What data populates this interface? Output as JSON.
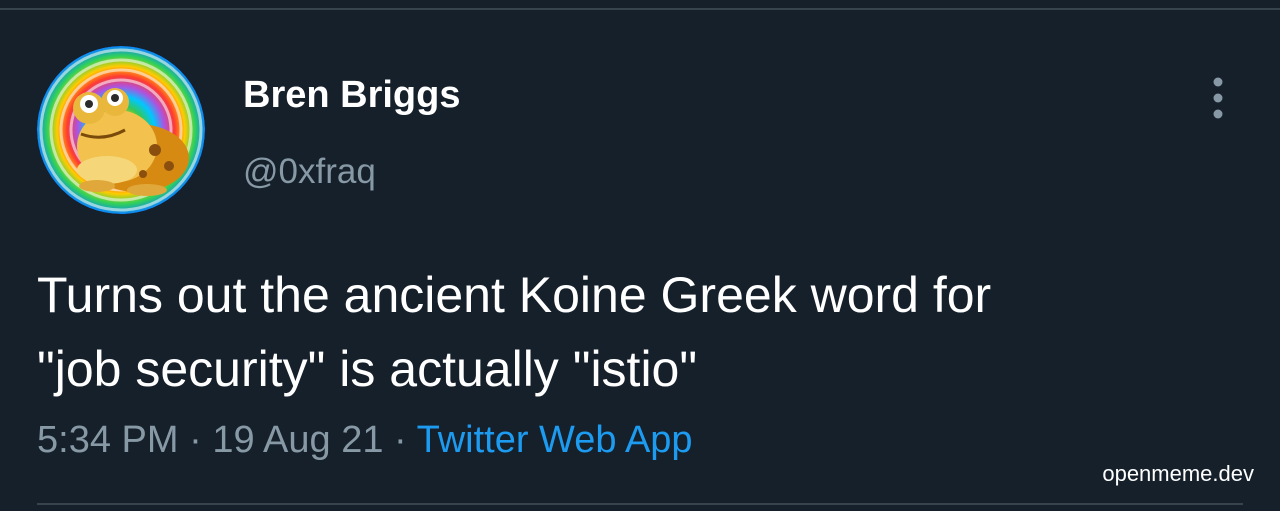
{
  "tweet": {
    "author": {
      "display_name": "Bren Briggs",
      "handle": "@0xfraq",
      "avatar_icon": "hypnotoad-avatar-icon"
    },
    "text_lines": [
      "Turns out the ancient Koine Greek word for",
      "\"job security\" is actually \"istio\""
    ],
    "time": "5:34 PM",
    "separator": "·",
    "date": "19 Aug 21",
    "source": "Twitter Web App",
    "more_icon": "more-vertical-icon"
  },
  "watermark": "openmeme.dev",
  "colors": {
    "background": "#15202b",
    "primary_text": "#ffffff",
    "secondary_text": "#8899a6",
    "link": "#1d9bf0",
    "divider": "#38444d"
  }
}
